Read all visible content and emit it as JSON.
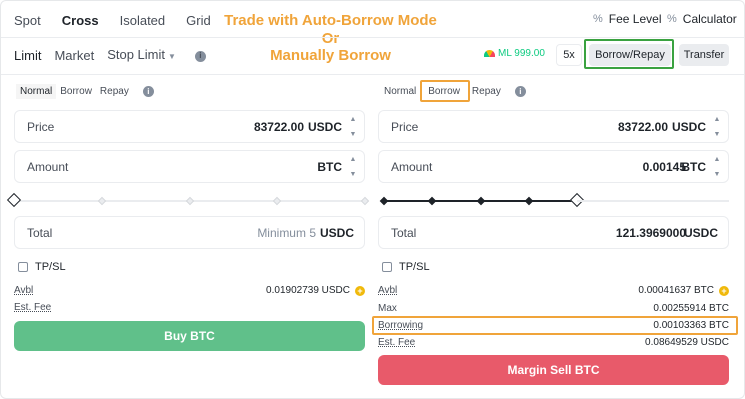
{
  "tabs": [
    "Spot",
    "Cross",
    "Isolated",
    "Grid"
  ],
  "overlay": {
    "line1": "Trade with Auto-Borrow Mode",
    "line2": "Or",
    "line3": "Manually Borrow"
  },
  "header_right": {
    "fee_level": "Fee Level",
    "calculator": "Calculator",
    "pct_glyph": "%"
  },
  "order_types": {
    "limit": "Limit",
    "market": "Market",
    "stop_limit": "Stop Limit"
  },
  "margin_level": "ML 999.00",
  "leverage": "5x",
  "borrow_repay": "Borrow/Repay",
  "transfer": "Transfer",
  "modes": [
    "Normal",
    "Borrow",
    "Repay"
  ],
  "buy": {
    "price_label": "Price",
    "price_value": "83722.00",
    "price_unit": "USDC",
    "amount_label": "Amount",
    "amount_unit": "BTC",
    "total_label": "Total",
    "total_placeholder": "Minimum 5",
    "total_unit": "USDC",
    "slider_percent": 0,
    "tpsl": "TP/SL",
    "avbl_label": "Avbl",
    "avbl_value": "0.01902739 USDC",
    "fee_label": "Est. Fee",
    "button": "Buy BTC"
  },
  "sell": {
    "price_label": "Price",
    "price_value": "83722.00",
    "price_unit": "USDC",
    "amount_label": "Amount",
    "amount_value": "0.00145",
    "amount_unit": "BTC",
    "total_label": "Total",
    "total_value": "121.3969000",
    "total_unit": "USDC",
    "slider_percent": 100,
    "tpsl": "TP/SL",
    "avbl_label": "Avbl",
    "avbl_value": "0.00041637 BTC",
    "max_label": "Max",
    "max_value": "0.00255914 BTC",
    "borrowing_label": "Borrowing",
    "borrowing_value": "0.00103363 BTC",
    "fee_label": "Est. Fee",
    "fee_value": "0.08649529 USDC",
    "button": "Margin Sell BTC"
  },
  "colors": {
    "buy": "#60c08a",
    "sell": "#e85a6a",
    "highlight_orange": "#f0a43a",
    "highlight_green": "#3aa240"
  },
  "icons": [
    "percent-icon",
    "info-icon",
    "gauge-icon",
    "plus-circle-icon",
    "caret-down-icon",
    "stepper-up-icon",
    "stepper-down-icon"
  ]
}
